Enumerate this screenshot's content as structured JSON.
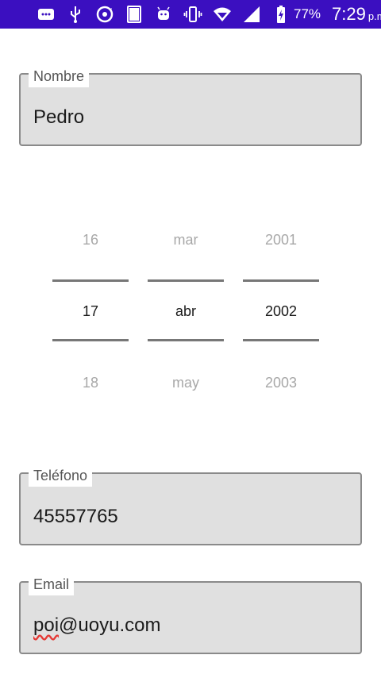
{
  "status_bar": {
    "battery_percent": "77%",
    "time": "7:29",
    "ampm": "p.m.",
    "icons": [
      "message-icon",
      "usb-icon",
      "chrome-sync-icon",
      "holy-bible-app-icon",
      "android-icon",
      "vibrate-icon",
      "wifi-icon",
      "signal-icon",
      "battery-charging-icon"
    ]
  },
  "form": {
    "nombre": {
      "label": "Nombre",
      "value": "Pedro"
    },
    "telefono": {
      "label": "Teléfono",
      "value": "45557765"
    },
    "email": {
      "label": "Email",
      "value": "poi@uoyu.com",
      "misspelled_part": "poi",
      "rest": "@uoyu.com"
    }
  },
  "date_picker": {
    "day": {
      "prev": "16",
      "current": "17",
      "next": "18"
    },
    "month": {
      "prev": "mar",
      "current": "abr",
      "next": "may"
    },
    "year": {
      "prev": "2001",
      "current": "2002",
      "next": "2003"
    }
  }
}
